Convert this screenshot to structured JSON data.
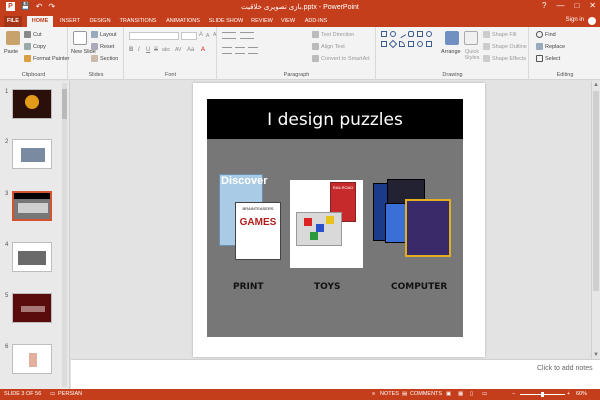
{
  "window": {
    "title": "بازی تصویری خلاقیت.pptx - PowerPoint",
    "controls": [
      "?",
      "—",
      "□",
      "✕"
    ]
  },
  "quick_access": {
    "save_glyph": "💾",
    "undo_glyph": "↶",
    "redo_glyph": "↷"
  },
  "tabs": [
    "FILE",
    "HOME",
    "INSERT",
    "DESIGN",
    "TRANSITIONS",
    "ANIMATIONS",
    "SLIDE SHOW",
    "REVIEW",
    "VIEW",
    "ADD-INS"
  ],
  "active_tab": "HOME",
  "account": {
    "signin_label": "Sign in"
  },
  "ribbon": {
    "clipboard": {
      "label": "Clipboard",
      "paste": "Paste",
      "cut": "Cut",
      "copy": "Copy",
      "format_painter": "Format Painter"
    },
    "slides": {
      "label": "Slides",
      "new_slide": "New Slide",
      "layout": "Layout",
      "reset": "Reset",
      "section": "Section"
    },
    "font": {
      "label": "Font",
      "bold": "B",
      "italic": "I",
      "underline": "U",
      "strike": "S",
      "shadow": "abc",
      "spacing": "AV",
      "case": "Aa",
      "color": "A",
      "grow": "A",
      "shrink": "A",
      "clear": "A"
    },
    "paragraph": {
      "label": "Paragraph",
      "text_direction": "Text Direction",
      "align_text": "Align Text",
      "convert_smartart": "Convert to SmartArt"
    },
    "drawing": {
      "label": "Drawing",
      "arrange": "Arrange",
      "quick_styles": "Quick Styles",
      "shape_fill": "Shape Fill",
      "shape_outline": "Shape Outline",
      "shape_effects": "Shape Effects"
    },
    "editing": {
      "label": "Editing",
      "find": "Find",
      "replace": "Replace",
      "select": "Select"
    }
  },
  "thumbnails": [
    {
      "num": "1",
      "bg": "#2a0f0a"
    },
    {
      "num": "2",
      "bg": "#ffffff"
    },
    {
      "num": "3",
      "bg": "#777777",
      "selected": true
    },
    {
      "num": "4",
      "bg": "#ffffff"
    },
    {
      "num": "5",
      "bg": "#5a0c0c"
    },
    {
      "num": "6",
      "bg": "#ffffff"
    }
  ],
  "slide": {
    "title": "I design puzzles",
    "categories": [
      "PRINT",
      "TOYS",
      "COMPUTER"
    ],
    "print_image": {
      "magazine": "Discover",
      "book": "GAMES",
      "book_header": "BRAINTEASERS"
    },
    "toys_image": {
      "box_label": "RAILROAD"
    }
  },
  "notes": {
    "placeholder": "Click to add notes"
  },
  "status": {
    "slide_counter": "SLIDE 3 OF 56",
    "language": "PERSIAN",
    "notes_label": "NOTES",
    "comments_label": "COMMENTS",
    "zoom": "60%"
  },
  "colors": {
    "accent": "#c43e1c",
    "slide_bg": "#777777",
    "title_bar": "#000000"
  }
}
